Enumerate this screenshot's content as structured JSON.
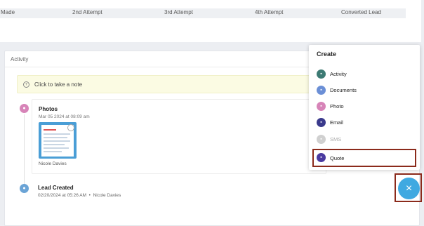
{
  "table": {
    "headers": [
      "Made",
      "2nd Attempt",
      "3rd Attempt",
      "4th Attempt",
      "Converted Lead"
    ]
  },
  "activity": {
    "title": "Activity",
    "note_placeholder": "Click to take a note",
    "items": [
      {
        "title": "Photos",
        "date": "Mar 05 2024 at 08:09 am",
        "author": "Nicole Davies"
      },
      {
        "title": "Lead Created",
        "meta": "02/20/2024 at 05:26 AM",
        "separator": "•",
        "author": "Nicole Davies"
      }
    ]
  },
  "create_menu": {
    "title": "Create",
    "items": [
      {
        "label": "Activity",
        "icon": "activity-icon",
        "color": "#3c7a73"
      },
      {
        "label": "Documents",
        "icon": "documents-icon",
        "color": "#6b8fd6"
      },
      {
        "label": "Photo",
        "icon": "photo-icon",
        "color": "#d784b8"
      },
      {
        "label": "Email",
        "icon": "email-icon",
        "color": "#3a3a8c"
      },
      {
        "label": "SMS",
        "icon": "sms-icon",
        "color": "#d0d0d0"
      },
      {
        "label": "Quote",
        "icon": "quote-icon",
        "color": "#4a3aa0"
      }
    ]
  },
  "fab": {
    "icon": "close-icon",
    "symbol": "×",
    "color": "#3fa9e1"
  }
}
